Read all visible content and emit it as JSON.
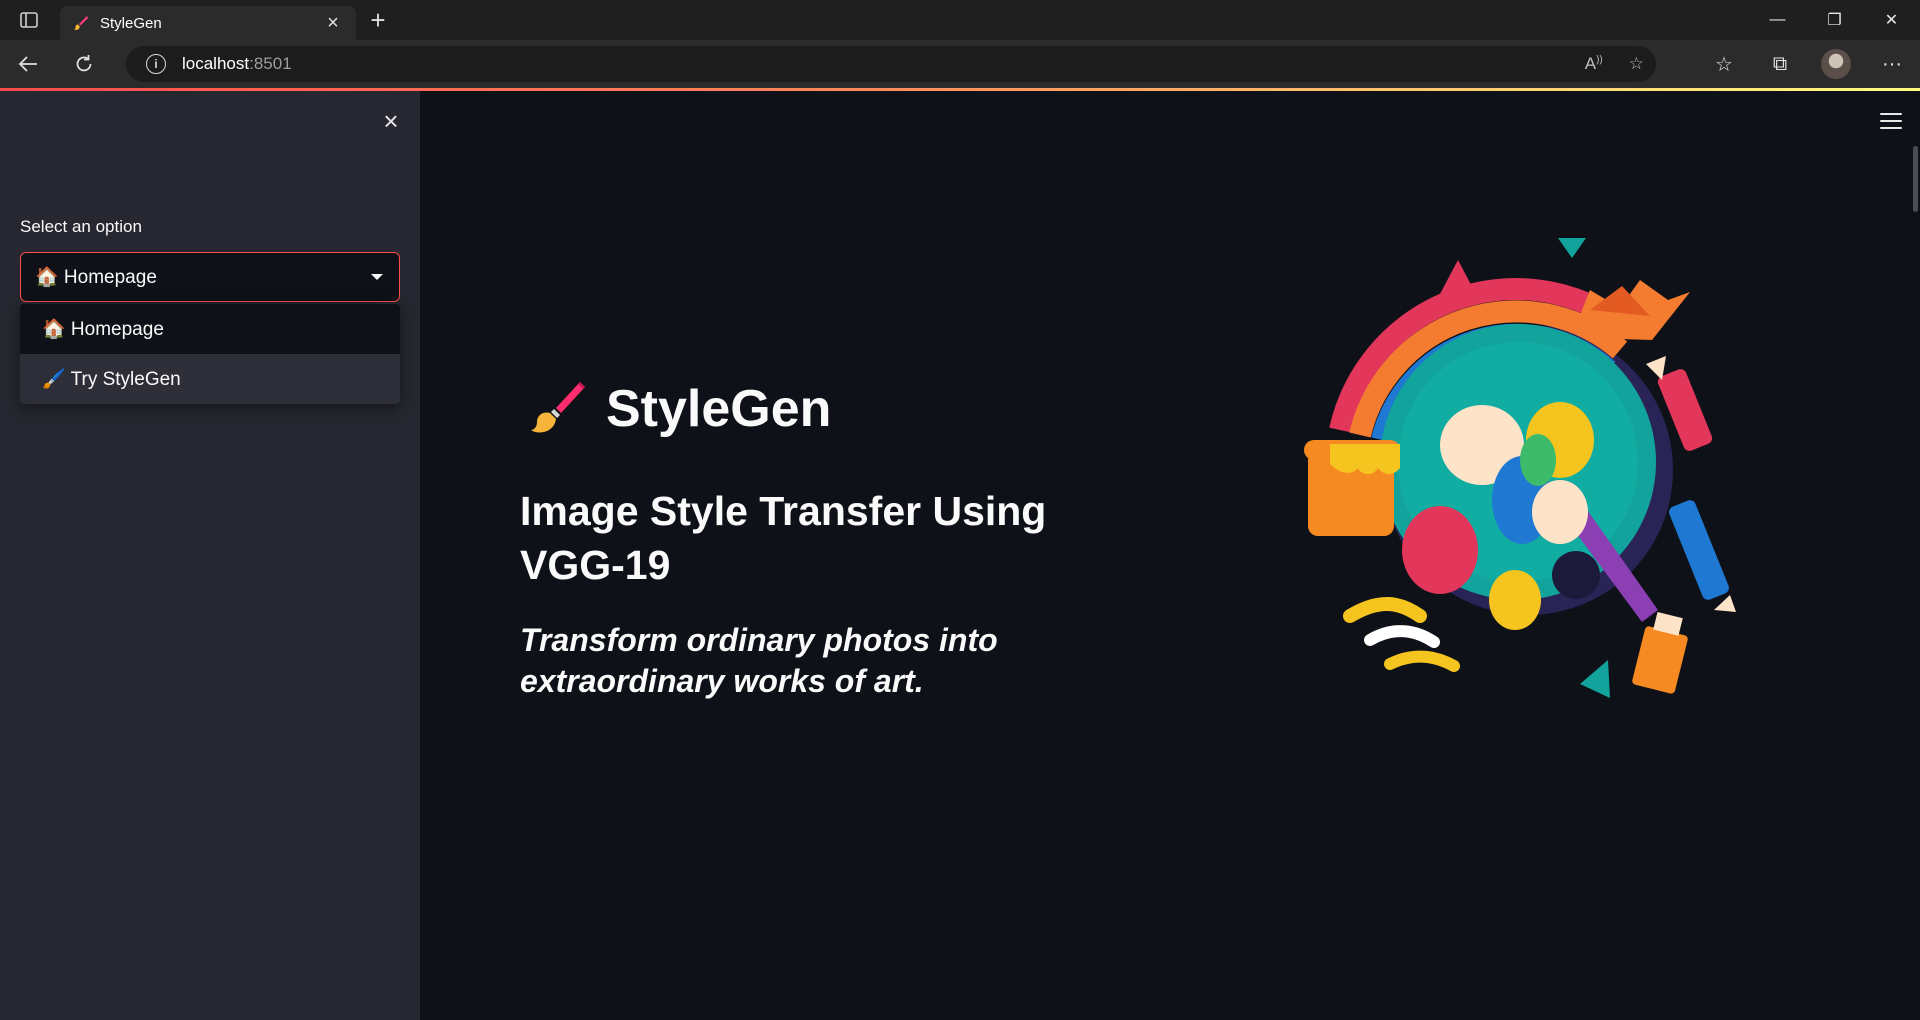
{
  "browser": {
    "tab_title": "StyleGen",
    "url_host": "localhost",
    "url_port": ":8501"
  },
  "sidebar": {
    "select_label": "Select an option",
    "selected_value": "🏠 Homepage",
    "options": [
      {
        "label": "🏠 Homepage"
      },
      {
        "label": "🖌️ Try StyleGen"
      }
    ]
  },
  "main": {
    "title": "StyleGen",
    "subtitle": "Image Style Transfer Using VGG-19",
    "tagline": "Transform ordinary photos into extraordinary works of art."
  },
  "icons": {
    "tab_icon": "paintbrush-icon",
    "title_icon": "paintbrush-icon",
    "hero_image": "art-palette-illustration"
  },
  "colors": {
    "accent": "#ff4b4b",
    "background": "#0e1117",
    "sidebar": "#262730"
  }
}
